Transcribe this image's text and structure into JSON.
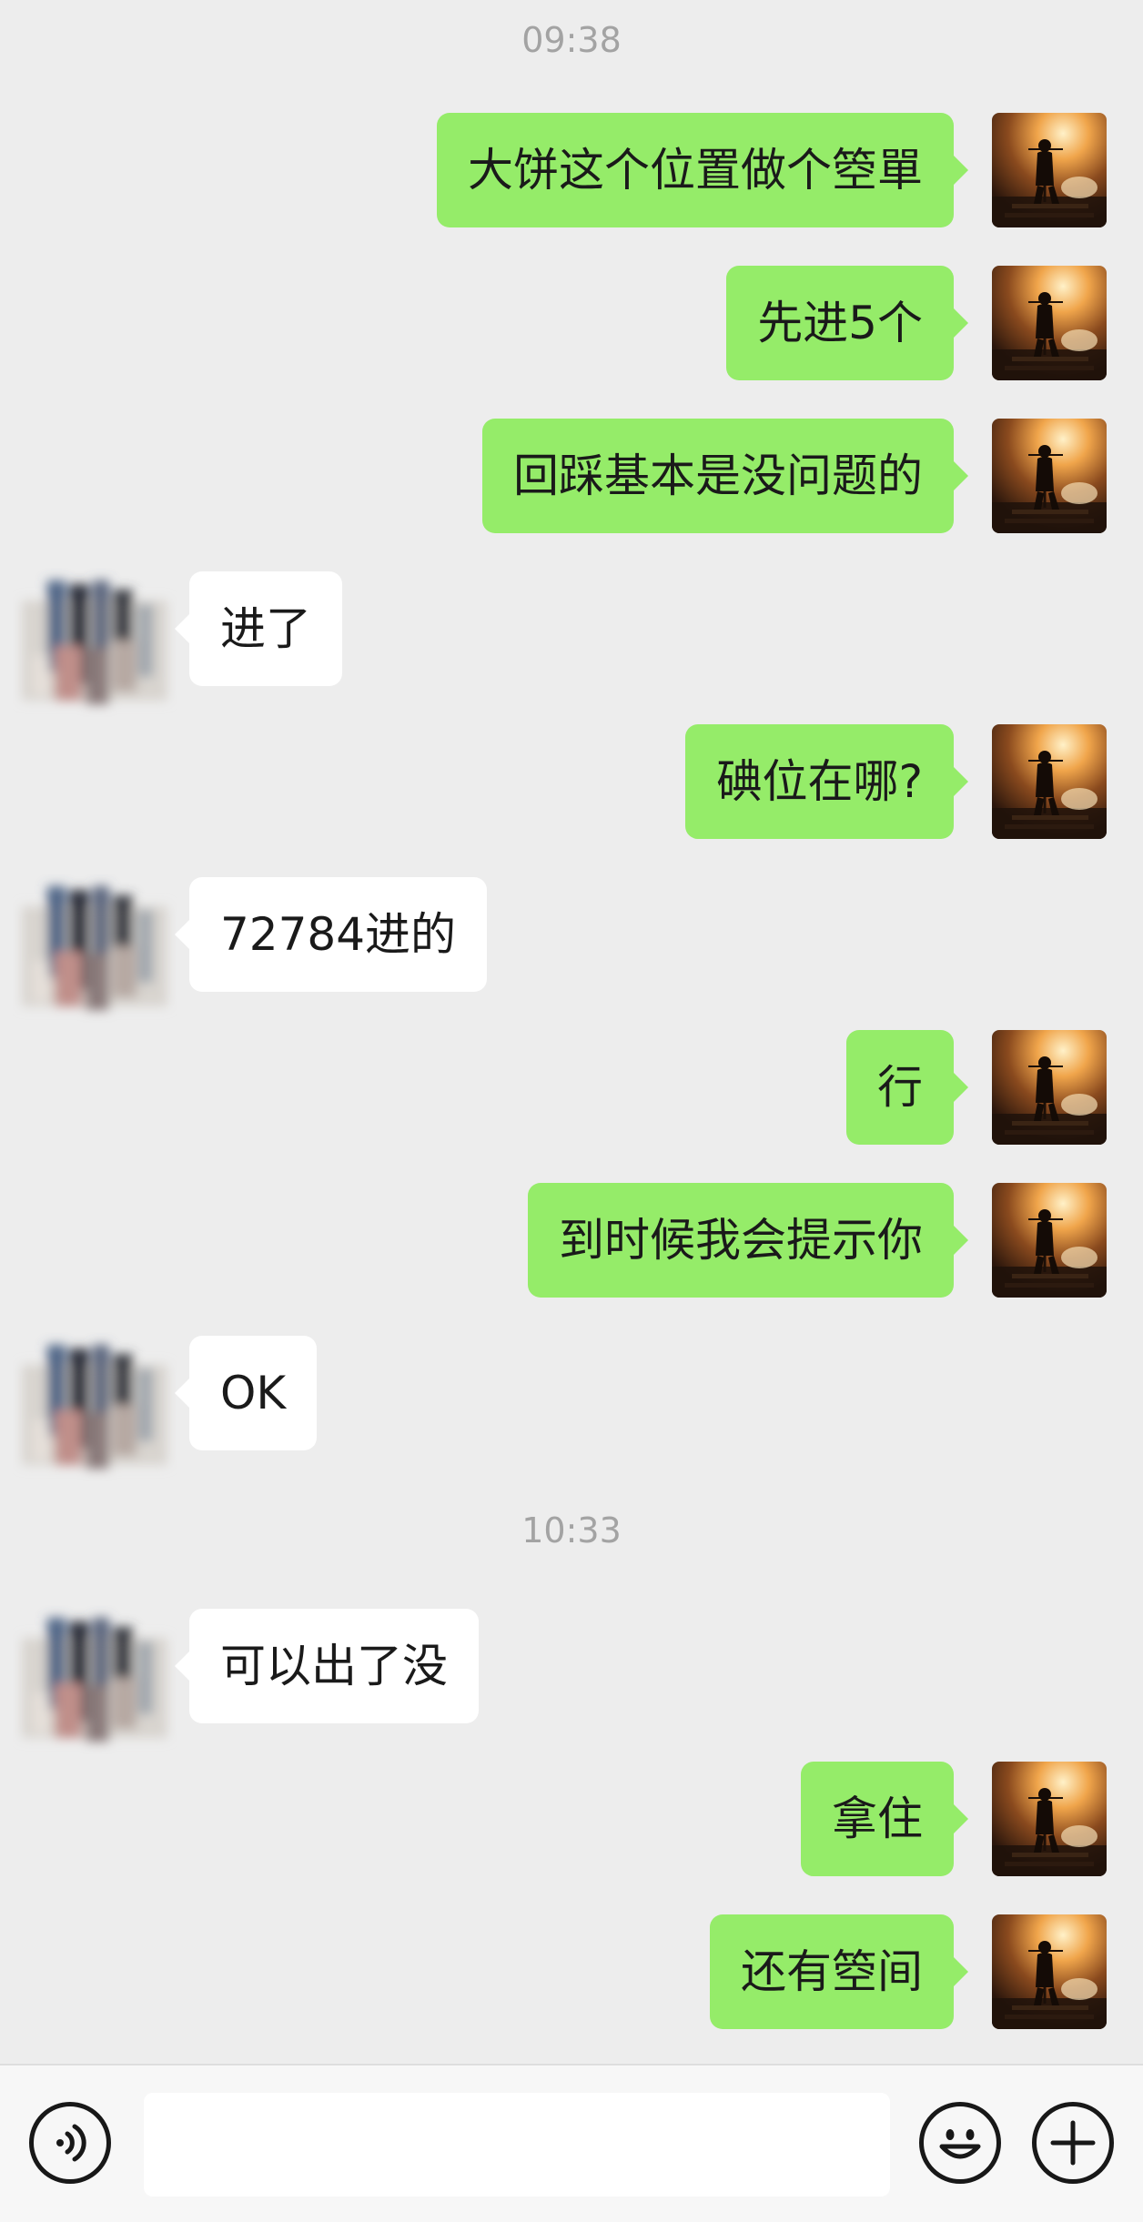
{
  "chat": {
    "timestamps": [
      "09:38",
      "10:33"
    ],
    "messages": [
      {
        "side": "out",
        "text": "大饼这个位置做个箜單"
      },
      {
        "side": "out",
        "text": "先进5个"
      },
      {
        "side": "out",
        "text": "回踩基本是没问题的"
      },
      {
        "side": "in",
        "text": "进了"
      },
      {
        "side": "out",
        "text": "碘位在哪?"
      },
      {
        "side": "in",
        "text": "72784进的"
      },
      {
        "side": "out",
        "text": "行"
      },
      {
        "side": "out",
        "text": "到时候我会提示你"
      },
      {
        "side": "in",
        "text": "OK"
      },
      {
        "side": "in",
        "text": "可以出了没"
      },
      {
        "side": "out",
        "text": "拿住"
      },
      {
        "side": "out",
        "text": "还有箜间"
      }
    ]
  },
  "input_bar": {
    "voice_icon": "voice-icon",
    "text_value": "",
    "emoji_icon": "emoji-icon",
    "plus_icon": "plus-icon"
  },
  "colors": {
    "background": "#ededed",
    "outgoing_bubble": "#95ec69",
    "incoming_bubble": "#ffffff",
    "timestamp": "#a3a3a3"
  }
}
